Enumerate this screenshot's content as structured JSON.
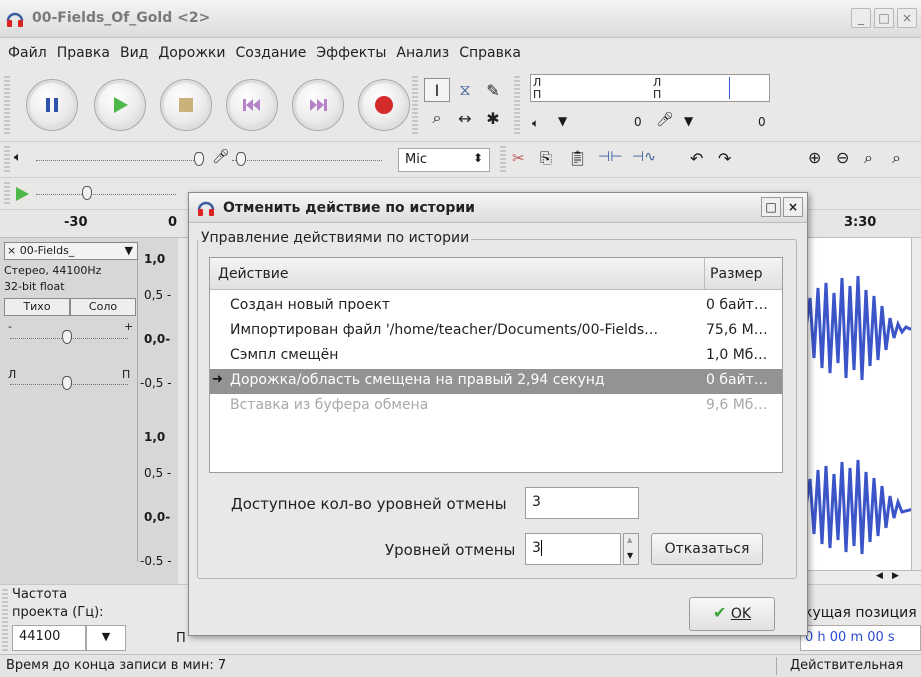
{
  "window": {
    "title": "00-Fields_Of_Gold <2>",
    "controls": [
      "_",
      "□",
      "×"
    ]
  },
  "menu": [
    "Файл",
    "Правка",
    "Вид",
    "Дорожки",
    "Создание",
    "Эффекты",
    "Анализ",
    "Справка"
  ],
  "toolbar": {
    "meter_left_l": "Л",
    "meter_left_r": "П",
    "meter_right_l": "Л",
    "meter_right_r": "П",
    "meter_value_left": "0",
    "meter_value_right": "0",
    "input_device": "Mic"
  },
  "ruler": {
    "labels": [
      "-30",
      "0",
      "3:30"
    ]
  },
  "track": {
    "name": "00-Fields_",
    "info_line1": "Стерео, 44100Hz",
    "info_line2": "32-bit float",
    "mute_label": "Тихо",
    "solo_label": "Соло",
    "gain_minus": "-",
    "gain_plus": "+",
    "pan_left": "Л",
    "pan_right": "П",
    "scale": [
      "1,0",
      "0,5 -",
      "0,0-",
      "-0,5 -",
      "1,0",
      "0,5 -",
      "0,0-",
      "-0.5 -"
    ]
  },
  "bottom": {
    "rate_label_1": "Частота",
    "rate_label_2": "проекта (Гц):",
    "rate_value": "44100",
    "cut_letter": "П",
    "position_label": "кущая позиция",
    "position_value": "0 h 00 m 00 s",
    "actual_label": "Действительная",
    "status_text": "Время до конца записи в мин: 7"
  },
  "dialog": {
    "title": "Отменить действие по истории",
    "group_title": "Управление действиями по истории",
    "col_action": "Действие",
    "col_size": "Размер",
    "rows": [
      {
        "action": "Создан новый проект",
        "size": "0 байт…",
        "state": "normal"
      },
      {
        "action": "Импортирован файл '/home/teacher/Documents/00-Fields…",
        "size": "75,6 М…",
        "state": "normal"
      },
      {
        "action": "Сэмпл смещён",
        "size": "1,0 Мб…",
        "state": "normal"
      },
      {
        "action": "Дорожка/область смещена на правый 2,94 секунд",
        "size": "0 байт…",
        "state": "selected"
      },
      {
        "action": "Вставка из буфера обмена",
        "size": "9,6 Мб…",
        "state": "dim"
      }
    ],
    "available_label": "Доступное кол-во уровней отмены",
    "available_value": "3",
    "levels_label": "Уровней отмены",
    "levels_value": "3",
    "discard_button": "Отказаться",
    "ok_button": "OK"
  }
}
